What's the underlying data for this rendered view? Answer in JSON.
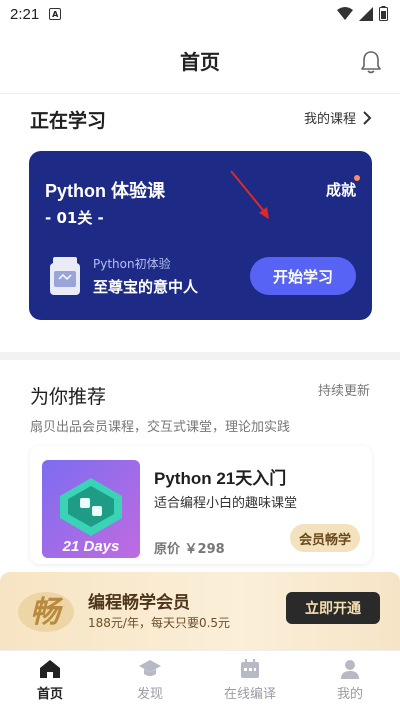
{
  "status_bar": {
    "time": "2:21",
    "notice_glyph": "A"
  },
  "header": {
    "title": "首页",
    "bell_icon": "bell-icon"
  },
  "learning": {
    "title": "正在学习",
    "my_courses_label": "我的课程",
    "card": {
      "title": "Python 体验课",
      "level": "- 01关 -",
      "achievement_label": "成就",
      "sub_label": "Python初体验",
      "sub_name": "至尊宝的意中人",
      "start_button": "开始学习",
      "bg_color": "#1d2b86",
      "button_color": "#5663f5"
    }
  },
  "recommend": {
    "title": "为你推荐",
    "more_label": "持续更新",
    "description": "扇贝出品会员课程，交互式课堂，理论加实践",
    "course": {
      "thumb_text": "21 Days",
      "title": "Python 21天入门",
      "subtitle": "适合编程小白的趣味课堂",
      "price": "原价 ￥298",
      "tag": "会员畅学"
    }
  },
  "vip": {
    "logo_text": "畅",
    "title": "编程畅学会员",
    "price_text": "188元/年，每天只要0.5元",
    "button": "立即开通"
  },
  "tabs": [
    {
      "label": "首页",
      "icon": "home-icon",
      "active": true
    },
    {
      "label": "发现",
      "icon": "graduation-cap-icon",
      "active": false
    },
    {
      "label": "在线编译",
      "icon": "calendar-icon",
      "active": false
    },
    {
      "label": "我的",
      "icon": "user-icon",
      "active": false
    }
  ]
}
